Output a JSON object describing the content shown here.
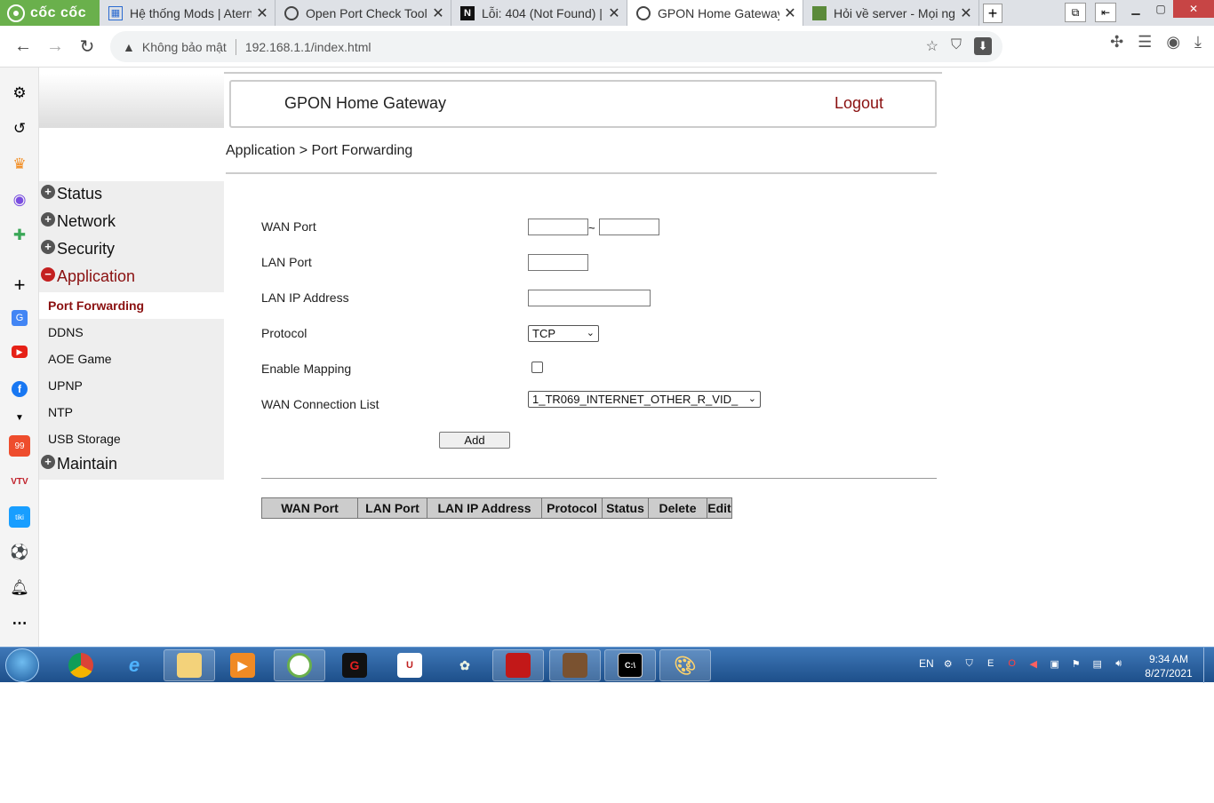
{
  "browser": {
    "brand": "cốc cốc",
    "tabs": [
      {
        "title": "Hệ thống Mods | Atern",
        "active": false
      },
      {
        "title": "Open Port Check Tool",
        "active": false
      },
      {
        "title": "Lỗi: 404 (Not Found) |",
        "active": false
      },
      {
        "title": "GPON Home Gateway",
        "active": true
      },
      {
        "title": "Hỏi về server - Mọi ng",
        "active": false
      }
    ],
    "security_label": "Không bảo mật",
    "url": "192.168.1.1/index.html"
  },
  "header": {
    "title": "GPON Home Gateway",
    "logout": "Logout"
  },
  "breadcrumb": "Application > Port Forwarding",
  "menu": {
    "status": "Status",
    "network": "Network",
    "security": "Security",
    "application": "Application",
    "sub": [
      "Port Forwarding",
      "DDNS",
      "AOE Game",
      "UPNP",
      "NTP",
      "USB Storage"
    ],
    "maintain": "Maintain"
  },
  "form": {
    "wan_port_label": "WAN Port",
    "lan_port_label": "LAN Port",
    "lan_ip_label": "LAN IP Address",
    "protocol_label": "Protocol",
    "protocol_value": "TCP",
    "enable_mapping_label": "Enable Mapping",
    "wan_conn_label": "WAN Connection List",
    "wan_conn_value": "1_TR069_INTERNET_OTHER_R_VID_",
    "range_sep": "~",
    "add_label": "Add"
  },
  "table": {
    "columns": [
      "WAN Port",
      "LAN Port",
      "LAN IP Address",
      "Protocol",
      "Status",
      "Delete",
      "Edit"
    ]
  },
  "taskbar": {
    "lang": "EN",
    "time": "9:34 AM",
    "date": "8/27/2021"
  },
  "colors": {
    "accent_red": "#8a1010",
    "brand_green": "#6ab04c",
    "taskbar_blue": "#2a5f9e"
  }
}
